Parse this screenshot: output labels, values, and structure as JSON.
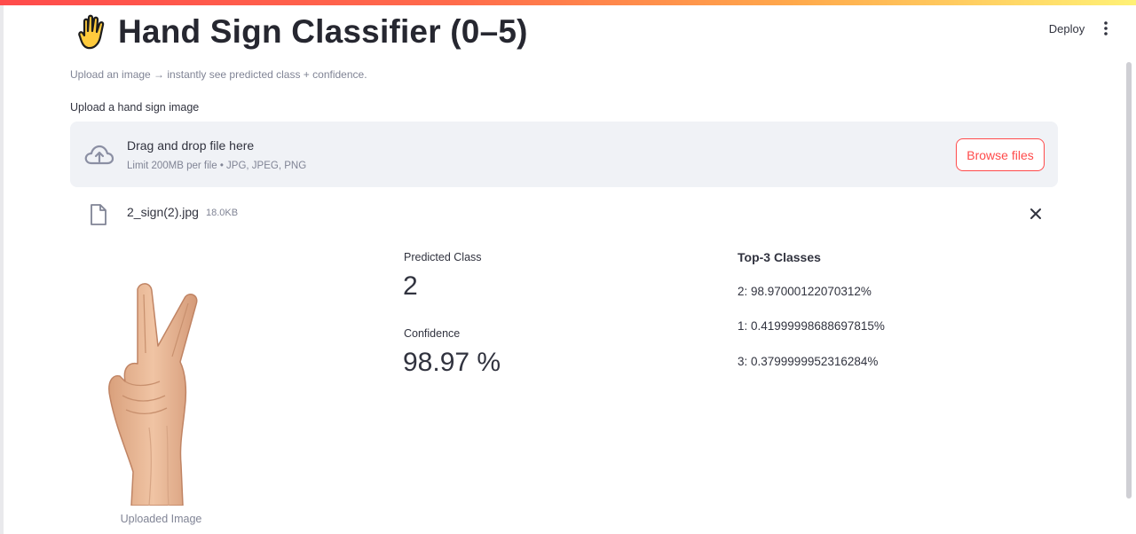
{
  "header": {
    "deploy_label": "Deploy",
    "menu_icon": "kebab-vertical-icon",
    "accent_gradient": [
      "#ff4b4b",
      "#ffa94b",
      "#fff176"
    ]
  },
  "page": {
    "title_emoji": "raised-hand-icon",
    "title": "Hand Sign Classifier (0–5)",
    "subtitle": "Upload an image → instantly see predicted class + confidence."
  },
  "uploader": {
    "label": "Upload a hand sign image",
    "icon": "cloud-upload-icon",
    "dropzone_title": "Drag and drop file here",
    "dropzone_limit": "Limit 200MB per file • JPG, JPEG, PNG",
    "browse_label": "Browse files",
    "accent_color": "#ff4b4b"
  },
  "uploaded_file": {
    "icon": "file-icon",
    "name": "2_sign(2).jpg",
    "size": "18.0KB",
    "remove_icon": "close-icon"
  },
  "image_panel": {
    "caption": "Uploaded Image"
  },
  "results": {
    "predicted_label": "Predicted Class",
    "predicted_value": "2",
    "confidence_label": "Confidence",
    "confidence_value": "98.97 %",
    "top3_heading": "Top-3 Classes",
    "top3": [
      "2: 98.97000122070312%",
      "1: 0.41999998688697815%",
      "3: 0.3799999952316284%"
    ]
  }
}
